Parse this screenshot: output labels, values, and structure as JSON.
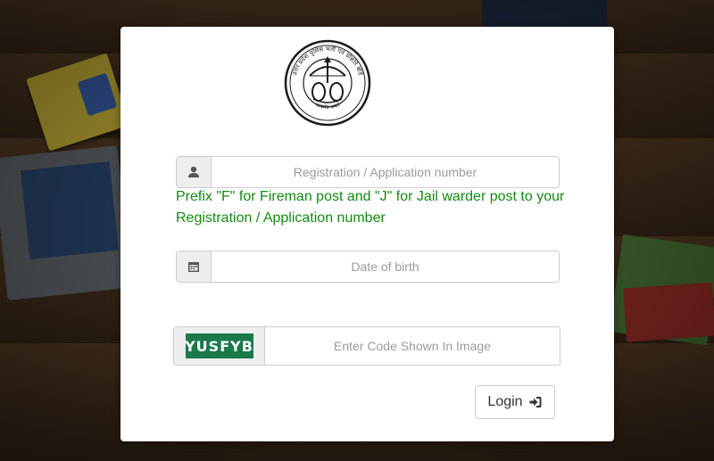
{
  "logo": {
    "top_text": "उत्तर प्रदेश पुलिस भर्ती एवं प्रोन्नति बोर्ड",
    "bottom_text": "सत्यमेव जयते"
  },
  "registration": {
    "icon": "user-icon",
    "placeholder": "Registration / Application number",
    "value": ""
  },
  "hint": {
    "text": "Prefix \"F\" for Fireman post and \"J\" for Jail warder post to your Registration / Application number",
    "color": "#138a13"
  },
  "dob": {
    "icon": "calendar-icon",
    "placeholder": "Date of birth",
    "value": ""
  },
  "captcha": {
    "code": "YUSFYB",
    "placeholder": "Enter Code Shown In Image",
    "value": ""
  },
  "login": {
    "label": "Login",
    "icon": "login-icon"
  }
}
